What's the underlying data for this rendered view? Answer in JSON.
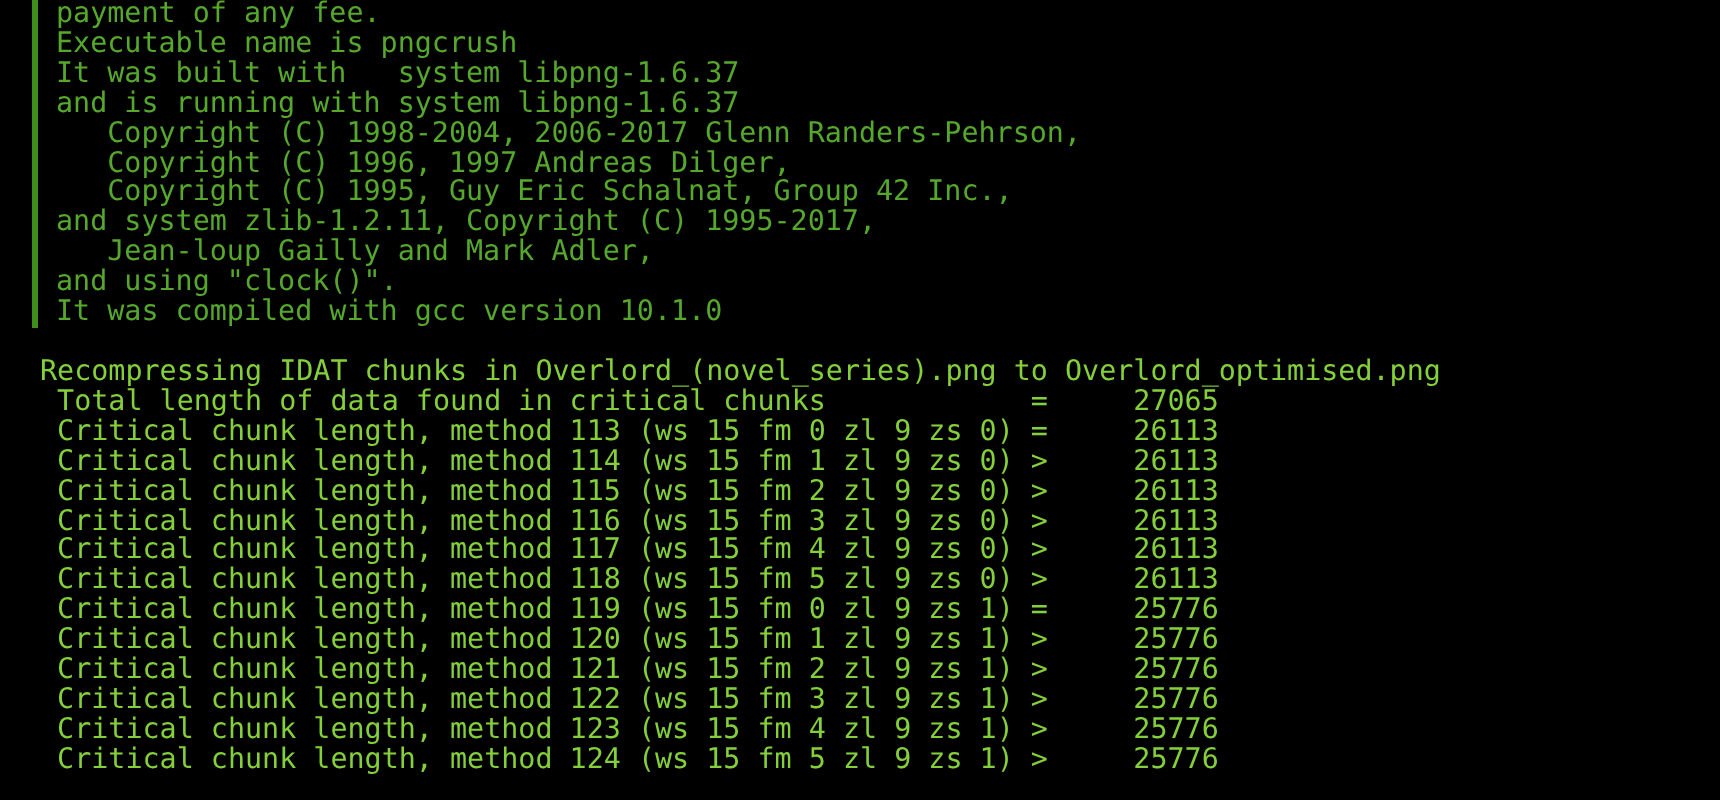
{
  "info_block": {
    "lines": [
      "payment of any fee.",
      "Executable name is pngcrush",
      "It was built with   system libpng-1.6.37",
      "and is running with system libpng-1.6.37",
      "   Copyright (C) 1998-2004, 2006-2017 Glenn Randers-Pehrson,",
      "   Copyright (C) 1996, 1997 Andreas Dilger,",
      "   Copyright (C) 1995, Guy Eric Schalnat, Group 42 Inc.,",
      "and system zlib-1.2.11, Copyright (C) 1995-2017,",
      "   Jean-loup Gailly and Mark Adler,",
      "and using \"clock()\".",
      "It was compiled with gcc version 10.1.0"
    ]
  },
  "output": {
    "lines": [
      "Recompressing IDAT chunks in Overlord_(novel_series).png to Overlord_optimised.png",
      " Total length of data found in critical chunks            =     27065",
      " Critical chunk length, method 113 (ws 15 fm 0 zl 9 zs 0) =     26113",
      " Critical chunk length, method 114 (ws 15 fm 1 zl 9 zs 0) >     26113",
      " Critical chunk length, method 115 (ws 15 fm 2 zl 9 zs 0) >     26113",
      " Critical chunk length, method 116 (ws 15 fm 3 zl 9 zs 0) >     26113",
      " Critical chunk length, method 117 (ws 15 fm 4 zl 9 zs 0) >     26113",
      " Critical chunk length, method 118 (ws 15 fm 5 zl 9 zs 0) >     26113",
      " Critical chunk length, method 119 (ws 15 fm 0 zl 9 zs 1) =     25776",
      " Critical chunk length, method 120 (ws 15 fm 1 zl 9 zs 1) >     25776",
      " Critical chunk length, method 121 (ws 15 fm 2 zl 9 zs 1) >     25776",
      " Critical chunk length, method 122 (ws 15 fm 3 zl 9 zs 1) >     25776",
      " Critical chunk length, method 123 (ws 15 fm 4 zl 9 zs 1) >     25776",
      " Critical chunk length, method 124 (ws 15 fm 5 zl 9 zs 1) >     25776"
    ]
  }
}
